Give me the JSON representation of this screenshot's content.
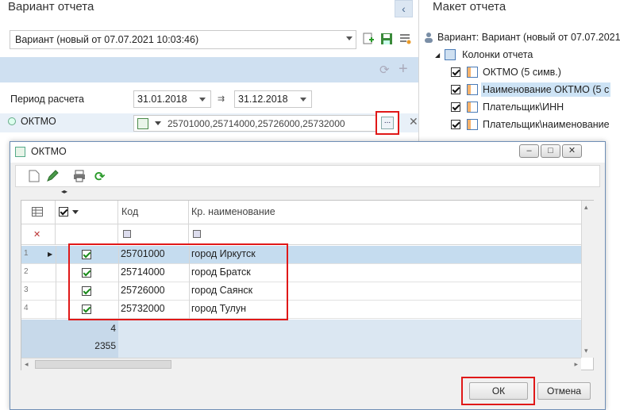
{
  "left_panel": {
    "title": "Вариант отчета",
    "variant_value": "Вариант (новый от 07.07.2021 10:03:46)",
    "period_label": "Период расчета",
    "date_from": "31.01.2018",
    "date_to": "31.12.2018",
    "oktmo_label": "ОКТМО",
    "oktmo_value": "25701000,25714000,25726000,25732000",
    "ellipsis_label": "..."
  },
  "right_panel": {
    "title": "Макет отчета",
    "variant_line": "Вариант: Вариант (новый от 07.07.2021",
    "columns_node": "Колонки отчета",
    "items": [
      {
        "label": "ОКТМО (5 симв.)",
        "checked": true
      },
      {
        "label": "Наименование ОКТМО (5 с",
        "checked": true
      },
      {
        "label": "Плательщик\\ИНН",
        "checked": true
      },
      {
        "label": "Плательщик\\наименование",
        "checked": true
      }
    ]
  },
  "dialog": {
    "title": "ОКТМО",
    "window_buttons": [
      "–",
      "□",
      "✕"
    ],
    "columns": {
      "code": "Код",
      "name": "Кр. наименование"
    },
    "rows": [
      {
        "num": "1",
        "code": "25701000",
        "name": "город Иркутск",
        "checked": true
      },
      {
        "num": "2",
        "code": "25714000",
        "name": "город Братск",
        "checked": true
      },
      {
        "num": "3",
        "code": "25726000",
        "name": "город Саянск",
        "checked": true
      },
      {
        "num": "4",
        "code": "25732000",
        "name": "город Тулун",
        "checked": true
      }
    ],
    "footer_count": "4",
    "footer_total": "2355",
    "ok_label": "ОК",
    "cancel_label": "Отмена"
  },
  "colors": {
    "accent_blue": "#cfe0f1",
    "highlight_red": "#e01818",
    "selected_row": "#c5dcef"
  }
}
